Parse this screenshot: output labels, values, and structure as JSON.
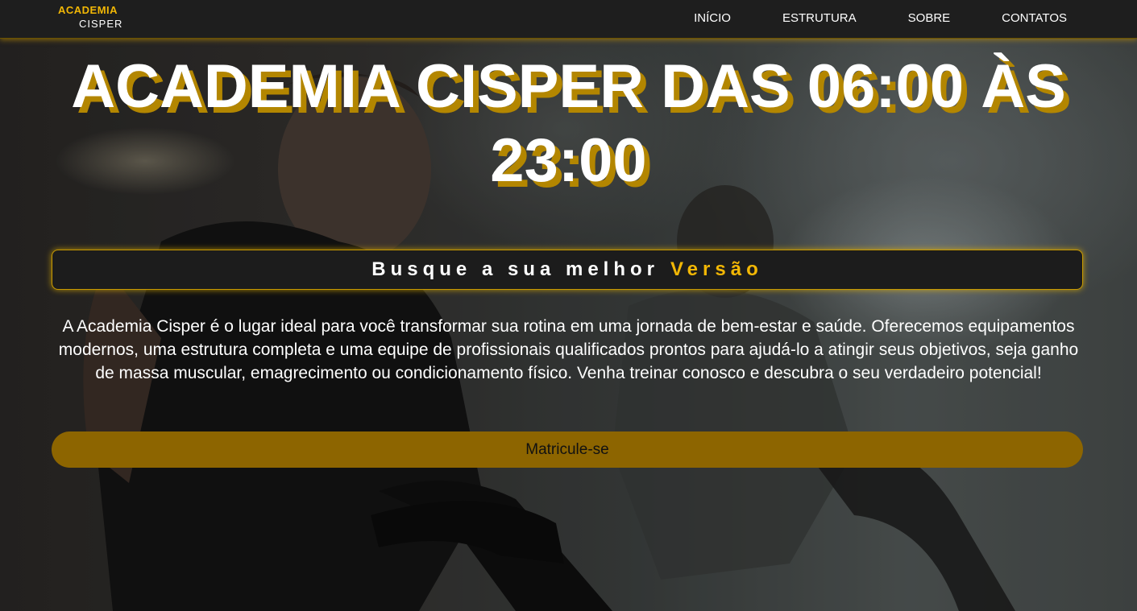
{
  "brand": {
    "name_top": "ACADEMIA",
    "name_bottom": "CISPER",
    "accent_color": "#f2b705"
  },
  "nav": {
    "items": [
      {
        "label": "INÍCIO"
      },
      {
        "label": "ESTRUTURA"
      },
      {
        "label": "SOBRE"
      },
      {
        "label": "CONTATOS"
      }
    ]
  },
  "hero": {
    "title": "ACADEMIA CISPER DAS 06:00 ÀS 23:00",
    "tagline_text": "Busque a sua melhor",
    "tagline_accent": "Versão",
    "description": "A Academia Cisper é o lugar ideal para você transformar sua rotina em uma jornada de bem-estar e saúde. Oferecemos equipamentos modernos, uma estrutura completa e uma equipe de profissionais qualificados prontos para ajudá-lo a atingir seus objetivos, seja ganho de massa muscular, emagrecimento ou condicionamento físico. Venha treinar conosco e descubra o seu verdadeiro potencial!",
    "cta_label": "Matricule-se",
    "cta_color": "#8d6500"
  }
}
